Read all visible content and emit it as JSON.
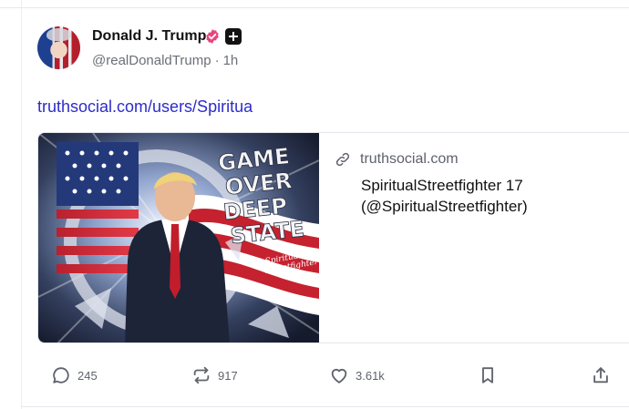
{
  "post": {
    "author_name": "Donald J. Trump",
    "handle": "@realDonaldTrump",
    "separator": "·",
    "time": "1h",
    "link_text": "truthsocial.com/users/Spiritua"
  },
  "card": {
    "domain": "truthsocial.com",
    "title": "SpiritualStreetfighter 17 (@SpiritualStreetfighter)",
    "image_text": "GAME OVER DEEP STATE",
    "image_badge": "Spiritual Streetfighter"
  },
  "actions": {
    "reply_count": "245",
    "retruth_count": "917",
    "like_count": "3.61k"
  },
  "colors": {
    "link": "#2d2cc9",
    "verified": "#e8447a",
    "muted": "#6b6f78"
  },
  "icons": [
    "verified-badge-icon",
    "plus-badge-icon",
    "link-icon",
    "reply-icon",
    "retruth-icon",
    "heart-icon",
    "bookmark-icon",
    "share-icon"
  ]
}
